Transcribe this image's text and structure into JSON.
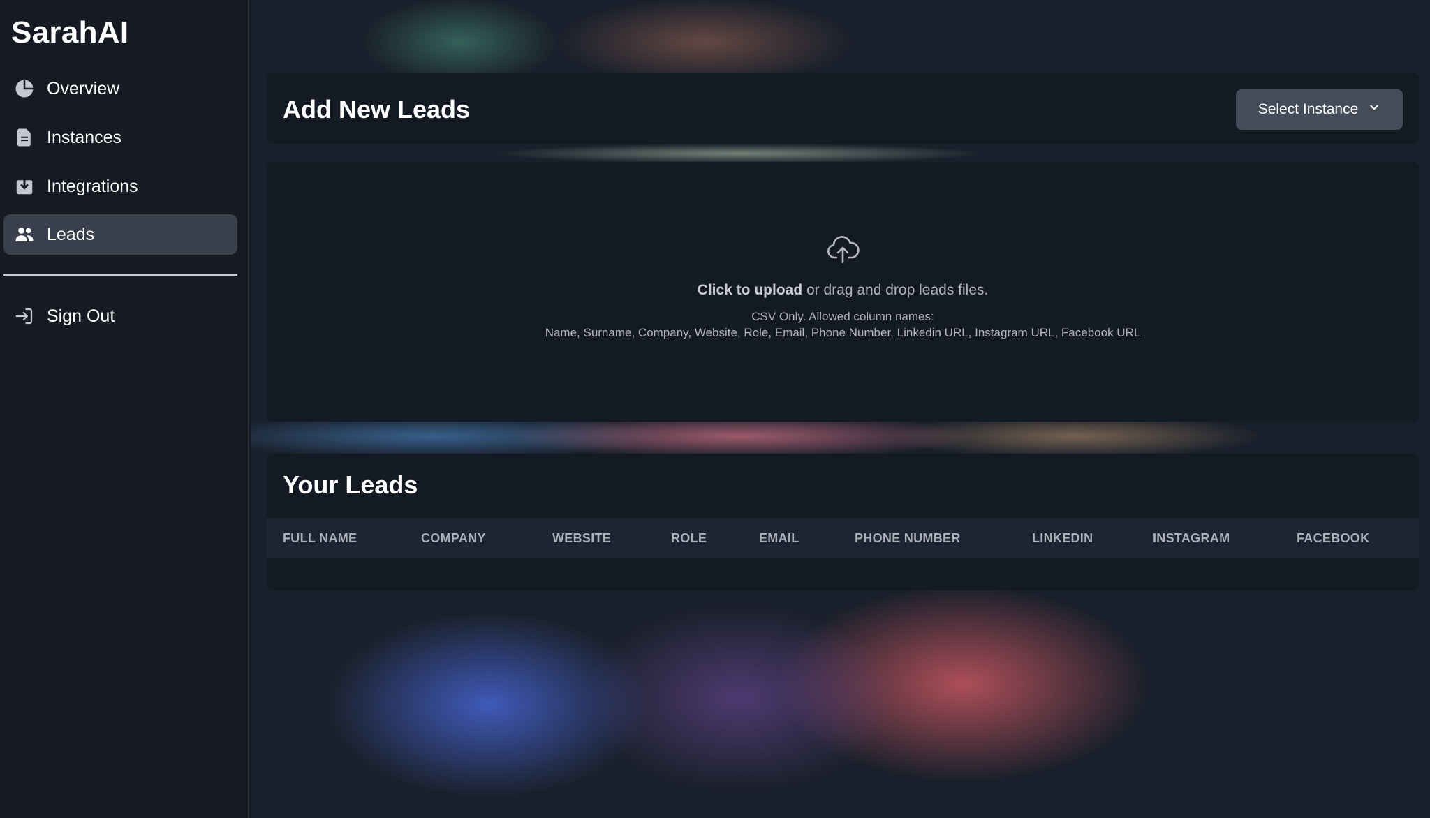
{
  "app": {
    "name": "SarahAI"
  },
  "sidebar": {
    "items": [
      {
        "label": "Overview",
        "icon": "pie-chart-icon"
      },
      {
        "label": "Instances",
        "icon": "document-icon"
      },
      {
        "label": "Integrations",
        "icon": "download-box-icon"
      },
      {
        "label": "Leads",
        "icon": "users-icon",
        "active": true
      }
    ],
    "sign_out": {
      "label": "Sign Out",
      "icon": "sign-in-arrow-icon"
    }
  },
  "add_leads": {
    "title": "Add New Leads",
    "select_instance": {
      "label": "Select Instance",
      "icon": "chevron-down-icon"
    },
    "upload": {
      "icon": "cloud-upload-icon",
      "click_text": "Click to upload",
      "rest_text": " or drag and drop leads files.",
      "csv_note": "CSV Only. Allowed column names:",
      "columns_note": "Name, Surname, Company, Website, Role, Email, Phone Number, Linkedin URL, Instagram URL, Facebook URL"
    }
  },
  "your_leads": {
    "title": "Your Leads",
    "columns": [
      "FULL NAME",
      "COMPANY",
      "WEBSITE",
      "ROLE",
      "EMAIL",
      "PHONE NUMBER",
      "LINKEDIN",
      "INSTAGRAM",
      "FACEBOOK"
    ],
    "rows": []
  },
  "colors": {
    "sidebar_bg": "#161a23",
    "card_bg": "#141a24",
    "active_item_bg": "#3a404c",
    "button_bg": "#454c59",
    "table_header_bg": "#1e2430"
  }
}
